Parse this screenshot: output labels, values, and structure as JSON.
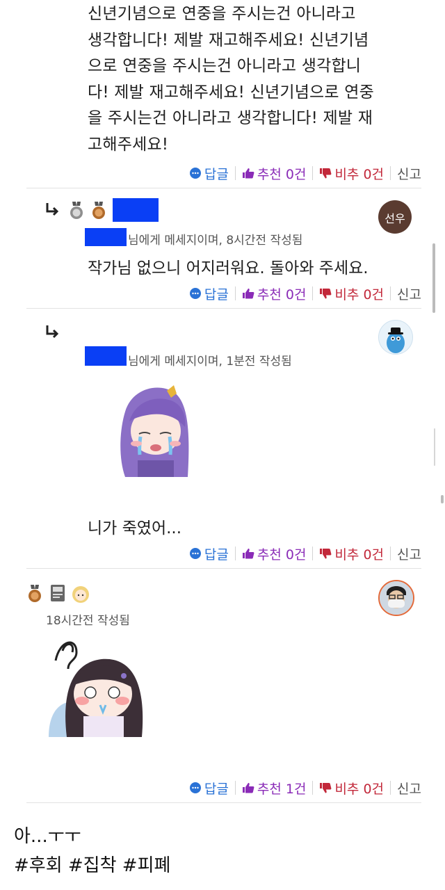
{
  "post": {
    "text": "신년기념으로 연중을 주시는건 아니라고\n생각합니다! 제발 재고해주세요! 신년기념\n으로 연중을 주시는건 아니라고 생각합니\n다! 제발 재고해주세요! 신년기념으로 연중\n을 주시는건 아니라고 생각합니다! 제발 재\n고해주세요!"
  },
  "actions_common": {
    "reply": "답글",
    "report": "신고"
  },
  "action_rows": [
    {
      "up": "추천 0건",
      "down": "비추 0건"
    },
    {
      "up": "추천 0건",
      "down": "비추 0건"
    },
    {
      "up": "추천 0건",
      "down": "비추 0건"
    },
    {
      "up": "추천 1건",
      "down": "비추 0건"
    }
  ],
  "comments": [
    {
      "avatar_text": "선우",
      "meta": "님에게 메세지이며, 8시간전 작성됨",
      "text": "작가님 없으니 어지러워요. 돌아와 주세요.",
      "avatar_color": "#5a3b30"
    },
    {
      "meta": "님에게 메세지이며, 1분전 작성됨",
      "text": "니가 죽였어..."
    },
    {
      "meta": "18시간전 작성됨"
    }
  ],
  "footer": {
    "line1": "아...ㅜㅜ",
    "line2": "#후회 #집착 #피폐"
  },
  "colors": {
    "reply": "#2a72d6",
    "recommend": "#8a2bb7",
    "downvote": "#c2283a",
    "redaction": "#0a3ff5"
  },
  "icons": [
    "reply-arrow-icon",
    "comment-bubble-icon",
    "thumbs-up-icon",
    "thumbs-down-icon",
    "medal-icon"
  ]
}
